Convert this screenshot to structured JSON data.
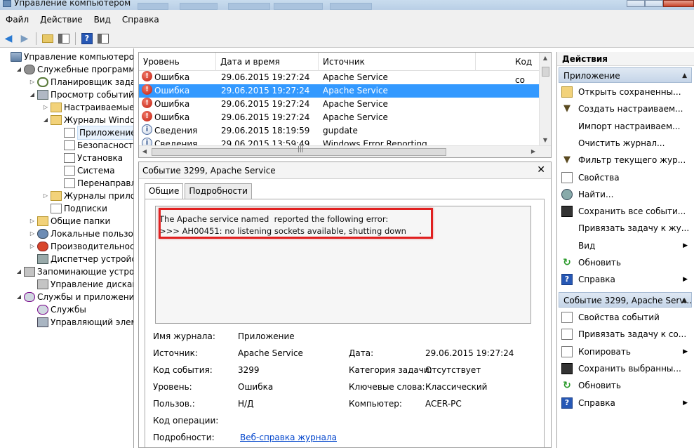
{
  "window": {
    "title": "Управление компьютером"
  },
  "menu": [
    "Файл",
    "Действие",
    "Вид",
    "Справка"
  ],
  "tree": [
    {
      "label": "Управление компьютером (л",
      "icon": "computer-icon",
      "depth": 0,
      "exp": "",
      "sel": false
    },
    {
      "label": "Служебные программы",
      "icon": "tools-icon",
      "depth": 1,
      "exp": "◢",
      "sel": false
    },
    {
      "label": "Планировщик заданий",
      "icon": "clock-icon",
      "depth": 2,
      "exp": "▷",
      "sel": false
    },
    {
      "label": "Просмотр событий",
      "icon": "event-viewer-icon",
      "depth": 2,
      "exp": "◢",
      "sel": false
    },
    {
      "label": "Настраиваемые пр",
      "icon": "folder-icon",
      "depth": 3,
      "exp": "▷",
      "sel": false
    },
    {
      "label": "Журналы Windows",
      "icon": "folder-icon",
      "depth": 3,
      "exp": "◢",
      "sel": false
    },
    {
      "label": "Приложение",
      "icon": "log-icon",
      "depth": 4,
      "exp": "",
      "sel": true
    },
    {
      "label": "Безопасность",
      "icon": "log-icon",
      "depth": 4,
      "exp": "",
      "sel": false
    },
    {
      "label": "Установка",
      "icon": "log-icon",
      "depth": 4,
      "exp": "",
      "sel": false
    },
    {
      "label": "Система",
      "icon": "log-icon",
      "depth": 4,
      "exp": "",
      "sel": false
    },
    {
      "label": "Перенаправлен",
      "icon": "log-icon",
      "depth": 4,
      "exp": "",
      "sel": false
    },
    {
      "label": "Журналы приложе",
      "icon": "folder-icon",
      "depth": 3,
      "exp": "▷",
      "sel": false
    },
    {
      "label": "Подписки",
      "icon": "log-icon",
      "depth": 3,
      "exp": "",
      "sel": false
    },
    {
      "label": "Общие папки",
      "icon": "shared-folder-icon",
      "depth": 2,
      "exp": "▷",
      "sel": false
    },
    {
      "label": "Локальные пользовате",
      "icon": "users-icon",
      "depth": 2,
      "exp": "▷",
      "sel": false
    },
    {
      "label": "Производительность",
      "icon": "performance-icon",
      "depth": 2,
      "exp": "▷",
      "sel": false
    },
    {
      "label": "Диспетчер устройств",
      "icon": "device-manager-icon",
      "depth": 2,
      "exp": "",
      "sel": false
    },
    {
      "label": "Запоминающие устройст",
      "icon": "storage-icon",
      "depth": 1,
      "exp": "◢",
      "sel": false
    },
    {
      "label": "Управление дисками",
      "icon": "disk-icon",
      "depth": 2,
      "exp": "",
      "sel": false
    },
    {
      "label": "Службы и приложения",
      "icon": "services-apps-icon",
      "depth": 1,
      "exp": "◢",
      "sel": false
    },
    {
      "label": "Службы",
      "icon": "services-icon",
      "depth": 2,
      "exp": "",
      "sel": false
    },
    {
      "label": "Управляющий элемен",
      "icon": "wmi-icon",
      "depth": 2,
      "exp": "",
      "sel": false
    }
  ],
  "list": {
    "columns": [
      "Уровень",
      "Дата и время",
      "Источник",
      "Код со"
    ],
    "rows": [
      {
        "level": "Ошибка",
        "type": "error",
        "date": "29.06.2015 19:27:24",
        "source": "Apache Service",
        "selected": false
      },
      {
        "level": "Ошибка",
        "type": "error",
        "date": "29.06.2015 19:27:24",
        "source": "Apache Service",
        "selected": true
      },
      {
        "level": "Ошибка",
        "type": "error",
        "date": "29.06.2015 19:27:24",
        "source": "Apache Service",
        "selected": false
      },
      {
        "level": "Ошибка",
        "type": "error",
        "date": "29.06.2015 19:27:24",
        "source": "Apache Service",
        "selected": false
      },
      {
        "level": "Сведения",
        "type": "info",
        "date": "29.06.2015 18:19:59",
        "source": "gupdate",
        "selected": false
      },
      {
        "level": "Сведения",
        "type": "info",
        "date": "29.06.2015 13:59:49",
        "source": "Windows Error Reporting",
        "selected": false
      }
    ]
  },
  "detail": {
    "header": "Событие 3299, Apache Service",
    "tabs": [
      "Общие",
      "Подробности"
    ],
    "message_line1": "The Apache service named  reported the following error:",
    "message_line2": ">>> AH00451: no listening sockets available, shutting down     .",
    "props": {
      "log_name_label": "Имя журнала:",
      "log_name": "Приложение",
      "source_label": "Источник:",
      "source": "Apache Service",
      "date_label": "Дата:",
      "date": "29.06.2015 19:27:24",
      "event_id_label": "Код события:",
      "event_id": "3299",
      "task_label": "Категория задачи:",
      "task": "Отсутствует",
      "level_label": "Уровень:",
      "level": "Ошибка",
      "keywords_label": "Ключевые слова:",
      "keywords": "Классический",
      "user_label": "Пользов.:",
      "user": "Н/Д",
      "computer_label": "Компьютер:",
      "computer": "ACER-PC",
      "opcode_label": "Код операции:",
      "more_label": "Подробности:",
      "more_link": "Веб-справка журнала"
    }
  },
  "actions": {
    "header": "Действия",
    "section1": "Приложение",
    "items1": [
      {
        "label": "Открыть сохраненны...",
        "icon": "open-icon",
        "sub": false
      },
      {
        "label": "Создать настраиваем...",
        "icon": "filter-icon",
        "sub": false
      },
      {
        "label": "Импорт настраиваем...",
        "icon": "",
        "sub": false
      },
      {
        "label": "Очистить журнал...",
        "icon": "",
        "sub": false
      },
      {
        "label": "Фильтр текущего жур...",
        "icon": "filter-icon",
        "sub": false
      },
      {
        "label": "Свойства",
        "icon": "properties-icon",
        "sub": false
      },
      {
        "label": "Найти...",
        "icon": "find-icon",
        "sub": false
      },
      {
        "label": "Сохранить все событи...",
        "icon": "save-icon",
        "sub": false
      },
      {
        "label": "Привязать задачу к жу...",
        "icon": "",
        "sub": false
      },
      {
        "label": "Вид",
        "icon": "",
        "sub": true
      },
      {
        "label": "Обновить",
        "icon": "refresh-icon",
        "sub": false
      },
      {
        "label": "Справка",
        "icon": "help-icon",
        "sub": true
      }
    ],
    "section2": "Событие 3299, Apache Serv...",
    "items2": [
      {
        "label": "Свойства событий",
        "icon": "properties-icon",
        "sub": false
      },
      {
        "label": "Привязать задачу к со...",
        "icon": "attach-task-icon",
        "sub": false
      },
      {
        "label": "Копировать",
        "icon": "copy-icon",
        "sub": true
      },
      {
        "label": "Сохранить выбранны...",
        "icon": "save-icon",
        "sub": false
      },
      {
        "label": "Обновить",
        "icon": "refresh-icon",
        "sub": false
      },
      {
        "label": "Справка",
        "icon": "help-icon",
        "sub": true
      }
    ]
  }
}
